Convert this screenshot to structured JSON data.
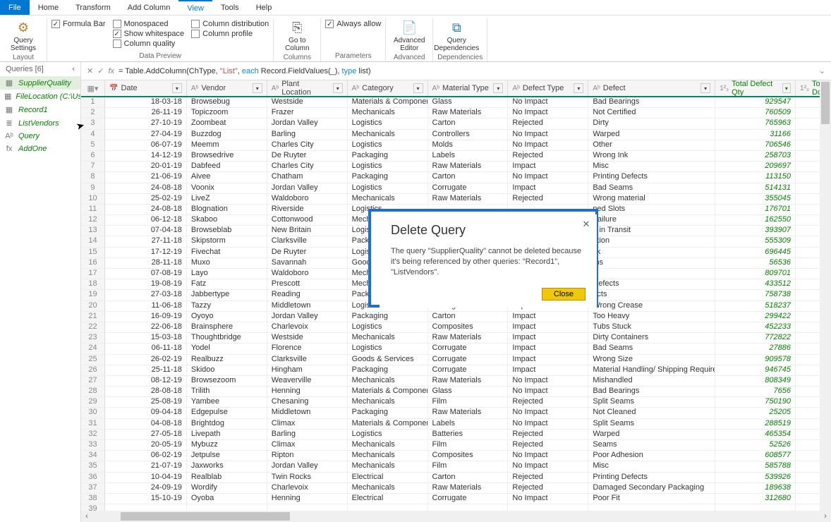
{
  "menu": {
    "file": "File",
    "home": "Home",
    "transform": "Transform",
    "addcol": "Add Column",
    "view": "View",
    "tools": "Tools",
    "help": "Help"
  },
  "ribbon": {
    "query_settings": "Query\nSettings",
    "layout_lbl": "Layout",
    "formula_bar": "Formula Bar",
    "monospaced": "Monospaced",
    "show_ws": "Show whitespace",
    "col_qual": "Column quality",
    "col_dist": "Column distribution",
    "col_prof": "Column profile",
    "always_allow": "Always allow",
    "datapreview_lbl": "Data Preview",
    "goto_col": "Go to\nColumn",
    "columns_lbl": "Columns",
    "adv_editor": "Advanced\nEditor",
    "adv_lbl": "Advanced",
    "query_deps": "Query\nDependencies",
    "deps_lbl": "Dependencies",
    "params_lbl": "Parameters"
  },
  "sidebar": {
    "header": "Queries [6]",
    "items": [
      {
        "icon": "▦",
        "label": "SupplierQuality"
      },
      {
        "icon": "▦",
        "label": "FileLocation (C:\\Users..."
      },
      {
        "icon": "▦",
        "label": "Record1"
      },
      {
        "icon": "≣",
        "label": "ListVendors"
      },
      {
        "icon": "Aᵇ",
        "label": "Query"
      },
      {
        "icon": "fx",
        "label": "AddOne"
      }
    ]
  },
  "formula": {
    "pre": "= Table.AddColumn(ChType, ",
    "s1": "\"List\"",
    "mid": ", ",
    "kw": "each",
    "post1": " Record.FieldValues(_), ",
    "kw2": "type",
    "post2": " list)"
  },
  "columns": {
    "date": "Date",
    "vendor": "Vendor",
    "plant": "Plant Location",
    "cat": "Category",
    "mat": "Material Type",
    "deft": "Defect Type",
    "defect": "Defect",
    "qty": "Total Defect Qty",
    "down": "Total Dov"
  },
  "rows": [
    {
      "d": "18-03-18",
      "v": "Browsebug",
      "p": "Westside",
      "c": "Materials & Components",
      "m": "Glass",
      "t": "No Impact",
      "f": "Bad Bearings",
      "q": "929547"
    },
    {
      "d": "26-11-19",
      "v": "Topiczoom",
      "p": "Frazer",
      "c": "Mechanicals",
      "m": "Raw Materials",
      "t": "No Impact",
      "f": "Not Certified",
      "q": "760509"
    },
    {
      "d": "27-10-19",
      "v": "Zoombeat",
      "p": "Jordan Valley",
      "c": "Logistics",
      "m": "Carton",
      "t": "Rejected",
      "f": "Dirty",
      "q": "765963"
    },
    {
      "d": "27-04-19",
      "v": "Buzzdog",
      "p": "Barling",
      "c": "Mechanicals",
      "m": "Controllers",
      "t": "No Impact",
      "f": "Warped",
      "q": "31166"
    },
    {
      "d": "06-07-19",
      "v": "Meemm",
      "p": "Charles City",
      "c": "Logistics",
      "m": "Molds",
      "t": "No Impact",
      "f": "Other",
      "q": "706546"
    },
    {
      "d": "14-12-19",
      "v": "Browsedrive",
      "p": "De Ruyter",
      "c": "Packaging",
      "m": "Labels",
      "t": "Rejected",
      "f": "Wrong Ink",
      "q": "258703"
    },
    {
      "d": "20-01-19",
      "v": "Dabfeed",
      "p": "Charles City",
      "c": "Logistics",
      "m": "Raw Materials",
      "t": "Impact",
      "f": "Misc",
      "q": "209697"
    },
    {
      "d": "21-06-19",
      "v": "Aivee",
      "p": "Chatham",
      "c": "Packaging",
      "m": "Carton",
      "t": "No Impact",
      "f": "Printing Defects",
      "q": "113150"
    },
    {
      "d": "24-08-18",
      "v": "Voonix",
      "p": "Jordan Valley",
      "c": "Logistics",
      "m": "Corrugate",
      "t": "Impact",
      "f": "Bad Seams",
      "q": "514131"
    },
    {
      "d": "25-02-19",
      "v": "LiveZ",
      "p": "Waldoboro",
      "c": "Mechanicals",
      "m": "Raw Materials",
      "t": "Rejected",
      "f": "Wrong material",
      "q": "355045"
    },
    {
      "d": "24-08-18",
      "v": "Blognation",
      "p": "Riverside",
      "c": "Logistics",
      "m": "",
      "t": "",
      "f": "ned Slots",
      "q": "176701"
    },
    {
      "d": "06-12-18",
      "v": "Skaboo",
      "p": "Cottonwood",
      "c": "Mechanic",
      "m": "",
      "t": "",
      "f": "Failure",
      "q": "162550"
    },
    {
      "d": "07-04-18",
      "v": "Browseblab",
      "p": "New Britain",
      "c": "Logistics",
      "m": "",
      "t": "",
      "f": "d in Transit",
      "q": "393907"
    },
    {
      "d": "27-11-18",
      "v": "Skipstorm",
      "p": "Clarksville",
      "c": "Packagin",
      "m": "",
      "t": "",
      "f": "ation",
      "q": "555309"
    },
    {
      "d": "17-12-19",
      "v": "Fivechat",
      "p": "De Ruyter",
      "c": "Logistics",
      "m": "",
      "t": "",
      "f": "ck",
      "q": "696445"
    },
    {
      "d": "28-11-18",
      "v": "Muxo",
      "p": "Savannah",
      "c": "Goods & S",
      "m": "",
      "t": "",
      "f": "ms",
      "q": "56536"
    },
    {
      "d": "07-08-19",
      "v": "Layo",
      "p": "Waldoboro",
      "c": "Mechanic",
      "m": "",
      "t": "",
      "f": "",
      "q": "809701"
    },
    {
      "d": "19-08-19",
      "v": "Fatz",
      "p": "Prescott",
      "c": "Mechanic",
      "m": "",
      "t": "",
      "f": "Defects",
      "q": "433512"
    },
    {
      "d": "27-03-18",
      "v": "Jabbertype",
      "p": "Reading",
      "c": "Packagin",
      "m": "",
      "t": "",
      "f": "ects",
      "q": "758738"
    },
    {
      "d": "11-06-18",
      "v": "Tazzy",
      "p": "Middletown",
      "c": "Logistics",
      "m": "Corrugate",
      "t": "Impact",
      "f": "Wrong Crease",
      "q": "518237"
    },
    {
      "d": "16-09-19",
      "v": "Oyoyo",
      "p": "Jordan Valley",
      "c": "Packaging",
      "m": "Carton",
      "t": "Impact",
      "f": "Too Heavy",
      "q": "299422"
    },
    {
      "d": "22-06-18",
      "v": "Brainsphere",
      "p": "Charlevoix",
      "c": "Logistics",
      "m": "Composites",
      "t": "Impact",
      "f": "Tubs Stuck",
      "q": "452233"
    },
    {
      "d": "15-03-18",
      "v": "Thoughtbridge",
      "p": "Westside",
      "c": "Mechanicals",
      "m": "Raw Materials",
      "t": "Impact",
      "f": "Dirty Containers",
      "q": "772822"
    },
    {
      "d": "06-11-18",
      "v": "Yodel",
      "p": "Florence",
      "c": "Logistics",
      "m": "Corrugate",
      "t": "Impact",
      "f": "Bad Seams",
      "q": "27886"
    },
    {
      "d": "26-02-19",
      "v": "Realbuzz",
      "p": "Clarksville",
      "c": "Goods & Services",
      "m": "Corrugate",
      "t": "Impact",
      "f": "Wrong  Size",
      "q": "909578"
    },
    {
      "d": "25-11-18",
      "v": "Skidoo",
      "p": "Hingham",
      "c": "Packaging",
      "m": "Corrugate",
      "t": "Impact",
      "f": "Material Handling/ Shipping Requirements Error",
      "q": "946745"
    },
    {
      "d": "08-12-19",
      "v": "Browsezoom",
      "p": "Weaverville",
      "c": "Mechanicals",
      "m": "Raw Materials",
      "t": "No Impact",
      "f": "Mishandled",
      "q": "808349"
    },
    {
      "d": "28-08-18",
      "v": "Trilith",
      "p": "Henning",
      "c": "Materials & Components",
      "m": "Glass",
      "t": "No Impact",
      "f": "Bad Bearings",
      "q": "7656"
    },
    {
      "d": "25-08-19",
      "v": "Yambee",
      "p": "Chesaning",
      "c": "Mechanicals",
      "m": "Film",
      "t": "Rejected",
      "f": "Split Seams",
      "q": "750190"
    },
    {
      "d": "09-04-18",
      "v": "Edgepulse",
      "p": "Middletown",
      "c": "Packaging",
      "m": "Raw Materials",
      "t": "No Impact",
      "f": "Not Cleaned",
      "q": "25205"
    },
    {
      "d": "04-08-18",
      "v": "Brightdog",
      "p": "Climax",
      "c": "Materials & Components",
      "m": "Labels",
      "t": "No Impact",
      "f": "Split Seams",
      "q": "288519"
    },
    {
      "d": "27-05-18",
      "v": "Livepath",
      "p": "Barling",
      "c": "Logistics",
      "m": "Batteries",
      "t": "Rejected",
      "f": "Warped",
      "q": "465354"
    },
    {
      "d": "20-05-19",
      "v": "Mybuzz",
      "p": "Climax",
      "c": "Mechanicals",
      "m": "Film",
      "t": "Rejected",
      "f": "Seams",
      "q": "52526"
    },
    {
      "d": "06-02-19",
      "v": "Jetpulse",
      "p": "Ripton",
      "c": "Mechanicals",
      "m": "Composites",
      "t": "No Impact",
      "f": "Poor  Adhesion",
      "q": "608577"
    },
    {
      "d": "21-07-19",
      "v": "Jaxworks",
      "p": "Jordan Valley",
      "c": "Mechanicals",
      "m": "Film",
      "t": "No Impact",
      "f": "Misc",
      "q": "585788"
    },
    {
      "d": "10-04-19",
      "v": "Realblab",
      "p": "Twin Rocks",
      "c": "Electrical",
      "m": "Carton",
      "t": "Rejected",
      "f": "Printing Defects",
      "q": "539926"
    },
    {
      "d": "24-09-19",
      "v": "Wordify",
      "p": "Charlevoix",
      "c": "Mechanicals",
      "m": "Raw Materials",
      "t": "Rejected",
      "f": "Damaged Secondary Packaging",
      "q": "189638"
    },
    {
      "d": "15-10-19",
      "v": "Oyoba",
      "p": "Henning",
      "c": "Electrical",
      "m": "Corrugate",
      "t": "No Impact",
      "f": "Poor Fit",
      "q": "312680"
    },
    {
      "d": "",
      "v": "",
      "p": "",
      "c": "",
      "m": "",
      "t": "",
      "f": "",
      "q": ""
    }
  ],
  "dialog": {
    "title": "Delete Query",
    "msg": "The query \"SupplierQuality\" cannot be deleted because it's being referenced by other queries: \"Record1\", \"ListVendors\".",
    "close": "Close"
  }
}
